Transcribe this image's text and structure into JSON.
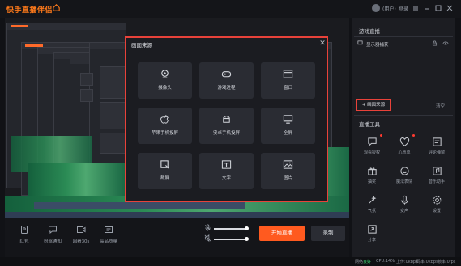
{
  "header": {
    "app_title": "快手直播伴侣",
    "user_name": "(用户)",
    "logout": "登录"
  },
  "modal": {
    "title": "画面来源",
    "sources": [
      {
        "label": "摄像头",
        "icon": "camera-icon"
      },
      {
        "label": "游戏进程",
        "icon": "gamepad-icon"
      },
      {
        "label": "窗口",
        "icon": "window-icon"
      },
      {
        "label": "苹果手机投屏",
        "icon": "apple-icon"
      },
      {
        "label": "安卓手机投屏",
        "icon": "android-icon"
      },
      {
        "label": "全屏",
        "icon": "monitor-icon"
      },
      {
        "label": "截屏",
        "icon": "crop-icon"
      },
      {
        "label": "文字",
        "icon": "text-icon"
      },
      {
        "label": "图片",
        "icon": "image-icon"
      }
    ]
  },
  "bottom_toolbar": {
    "items": [
      {
        "label": "红包",
        "icon": "red-packet-icon"
      },
      {
        "label": "粉丝通知",
        "icon": "message-icon"
      },
      {
        "label": "回看30s",
        "icon": "replay-icon"
      },
      {
        "label": "高品质量",
        "icon": "quality-icon"
      }
    ],
    "start_live": "开始直播",
    "record": "录制"
  },
  "right_panel": {
    "scenes_title": "游戏直播",
    "scene_item": "显示器捕获",
    "add_source": "+ 画面来源",
    "clear": "清空",
    "tools_title": "直播工具",
    "tools": [
      {
        "label": "观看授权",
        "icon": "chat-icon",
        "dot": true
      },
      {
        "label": "心愿单",
        "icon": "heart-icon",
        "dot": true
      },
      {
        "label": "评论弹窗",
        "icon": "comment-icon",
        "dot": false
      },
      {
        "label": "抽奖",
        "icon": "gift-icon",
        "dot": false
      },
      {
        "label": "魔法表情",
        "icon": "magic-icon",
        "dot": false
      },
      {
        "label": "音乐助手",
        "icon": "music-icon",
        "dot": false
      },
      {
        "label": "气氛",
        "icon": "wand-icon",
        "dot": false
      },
      {
        "label": "变声",
        "icon": "voice-icon",
        "dot": false
      },
      {
        "label": "设置",
        "icon": "gear-icon",
        "dot": false
      },
      {
        "label": "分享",
        "icon": "share-icon",
        "dot": false
      }
    ]
  },
  "status": {
    "network_label": "网络",
    "network_value": "良好",
    "cpu": "CPU:14%",
    "upload": "上传:0kbps",
    "bitrate": "码率:0kbps",
    "fps": "帧率:0fps"
  },
  "colors": {
    "accent": "#ff5a1f",
    "highlight": "#e8423a"
  }
}
